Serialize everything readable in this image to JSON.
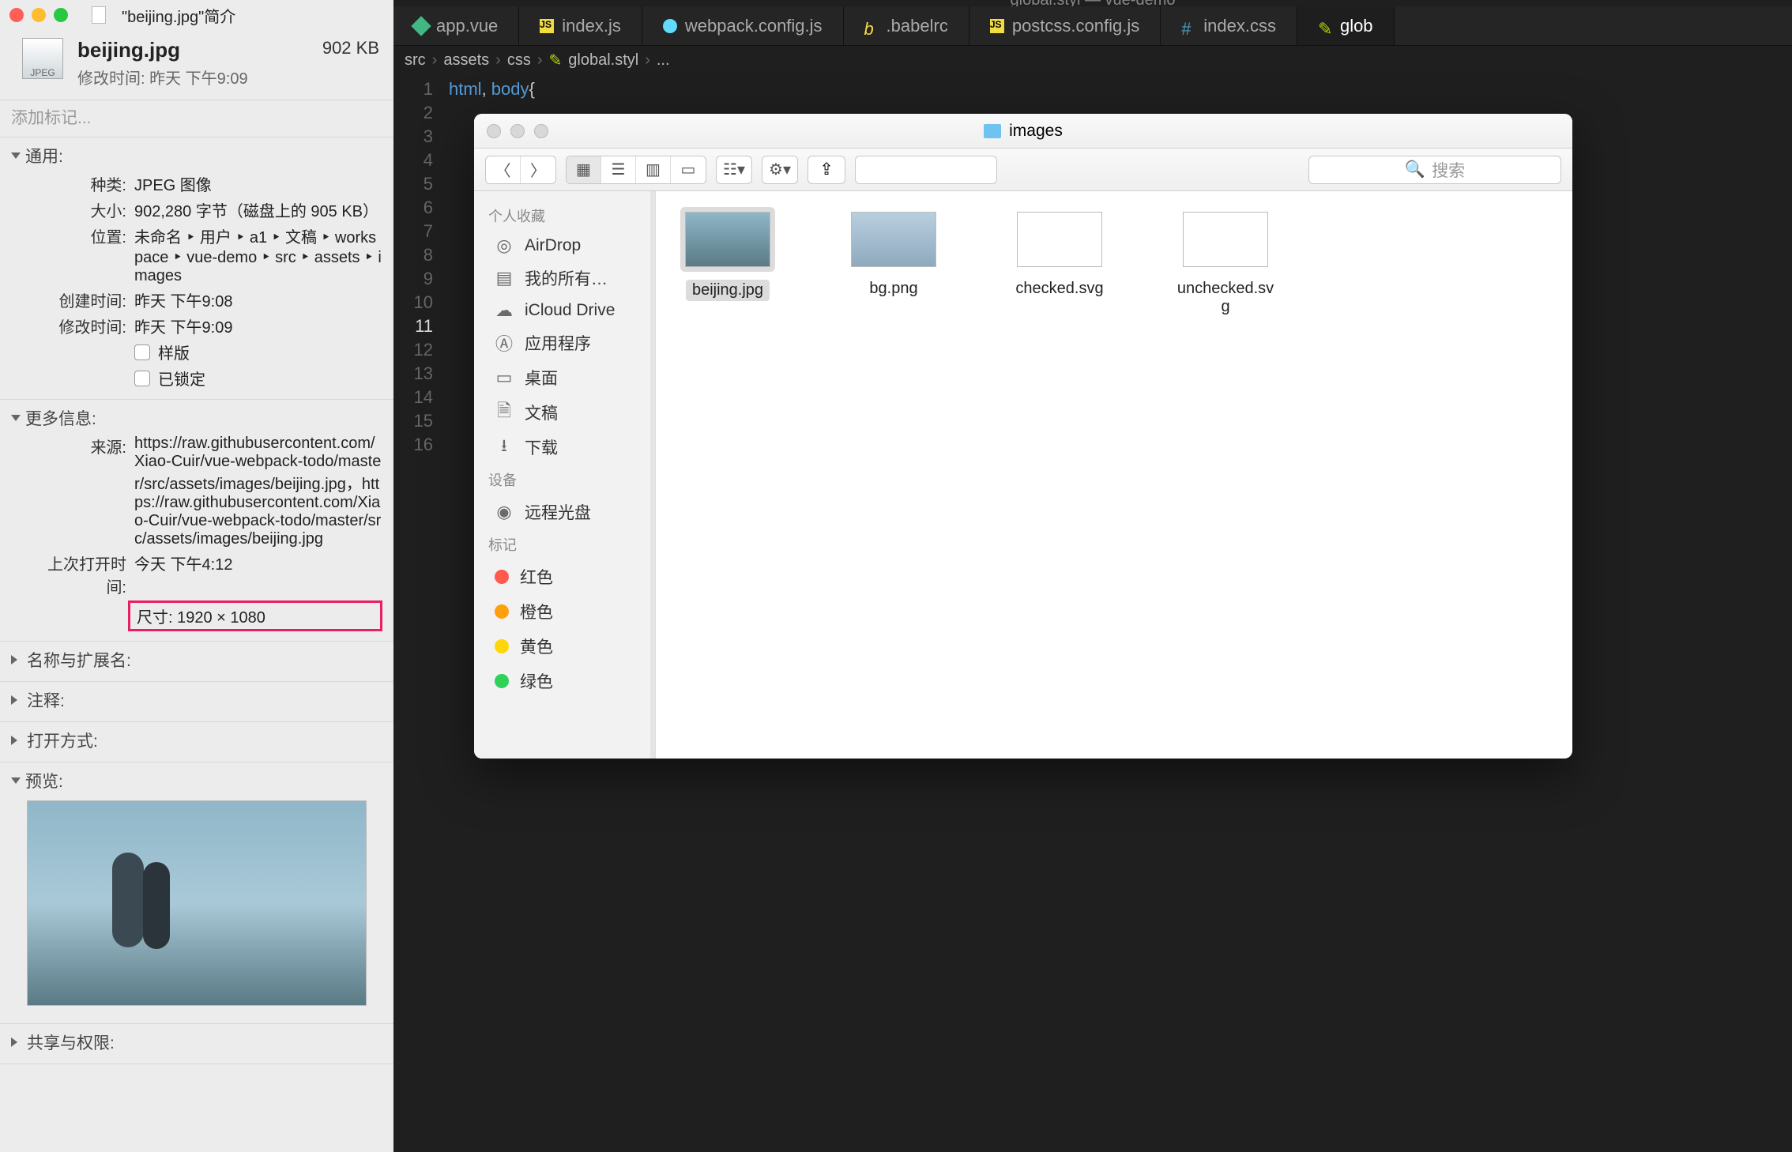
{
  "info_panel": {
    "window_title": "\"beijing.jpg\"简介",
    "file_name": "beijing.jpg",
    "file_size_short": "902 KB",
    "modified_line": "修改时间: 昨天 下午9:09",
    "tags_placeholder": "添加标记...",
    "sections": {
      "general": {
        "title": "通用:"
      },
      "more": {
        "title": "更多信息:"
      },
      "name_ext": {
        "title": "名称与扩展名:"
      },
      "comments": {
        "title": "注释:"
      },
      "open_with": {
        "title": "打开方式:"
      },
      "preview": {
        "title": "预览:"
      },
      "sharing": {
        "title": "共享与权限:"
      }
    },
    "kv": {
      "kind_label": "种类:",
      "kind_value": "JPEG 图像",
      "size_label": "大小:",
      "size_value": "902,280 字节（磁盘上的 905 KB）",
      "where_label": "位置:",
      "where_value": "未命名 ‣ 用户 ‣ a1 ‣ 文稿 ‣ workspace ‣ vue-demo ‣ src ‣ assets ‣ images",
      "created_label": "创建时间:",
      "created_value": "昨天 下午9:08",
      "modified_label": "修改时间:",
      "modified_value": "昨天 下午9:09",
      "stationery_label": "样版",
      "locked_label": "已锁定",
      "source_label": "来源:",
      "source_value": "https://raw.githubusercontent.com/Xiao-Cuir/vue-webpack-todo/master/src/assets/images/beijing.jpg，https://raw.githubusercontent.com/Xiao-Cuir/vue-webpack-todo/master/src/assets/images/beijing.jpg",
      "last_open_label": "上次打开时间:",
      "last_open_value": "今天 下午4:12",
      "dimensions_label": "尺寸:",
      "dimensions_value": "1920 × 1080"
    }
  },
  "editor": {
    "window_title": "global.styl — vue-demo",
    "tabs": [
      {
        "label": "app.vue",
        "icon": "vue"
      },
      {
        "label": "index.js",
        "icon": "js"
      },
      {
        "label": "webpack.config.js",
        "icon": "gear"
      },
      {
        "label": ".babelrc",
        "icon": "babel"
      },
      {
        "label": "postcss.config.js",
        "icon": "js"
      },
      {
        "label": "index.css",
        "icon": "css"
      },
      {
        "label": "glob",
        "icon": "styl",
        "active": true
      }
    ],
    "breadcrumbs": [
      "src",
      "assets",
      "css",
      "global.styl",
      "..."
    ],
    "line_count": 16,
    "current_line": 11,
    "code_line_1": "html, body{"
  },
  "finder": {
    "title": "images",
    "search_placeholder": "搜索",
    "sidebar": {
      "favorites_head": "个人收藏",
      "favorites": [
        {
          "icon": "airdrop",
          "label": "AirDrop"
        },
        {
          "icon": "allmy",
          "label": "我的所有…"
        },
        {
          "icon": "icloud",
          "label": "iCloud Drive"
        },
        {
          "icon": "apps",
          "label": "应用程序"
        },
        {
          "icon": "desktop",
          "label": "桌面"
        },
        {
          "icon": "docs",
          "label": "文稿"
        },
        {
          "icon": "downloads",
          "label": "下载"
        }
      ],
      "devices_head": "设备",
      "devices": [
        {
          "icon": "disc",
          "label": "远程光盘"
        }
      ],
      "tags_head": "标记",
      "tags": [
        {
          "color": "#ff5b4c",
          "label": "红色"
        },
        {
          "color": "#ff9f0a",
          "label": "橙色"
        },
        {
          "color": "#ffd60a",
          "label": "黄色"
        },
        {
          "color": "#30d158",
          "label": "绿色"
        }
      ]
    },
    "files": [
      {
        "name": "beijing.jpg",
        "selected": true,
        "thumb": "img1"
      },
      {
        "name": "bg.png",
        "thumb": "img2"
      },
      {
        "name": "checked.svg",
        "thumb": "blank"
      },
      {
        "name": "unchecked.svg",
        "thumb": "blank"
      }
    ]
  }
}
